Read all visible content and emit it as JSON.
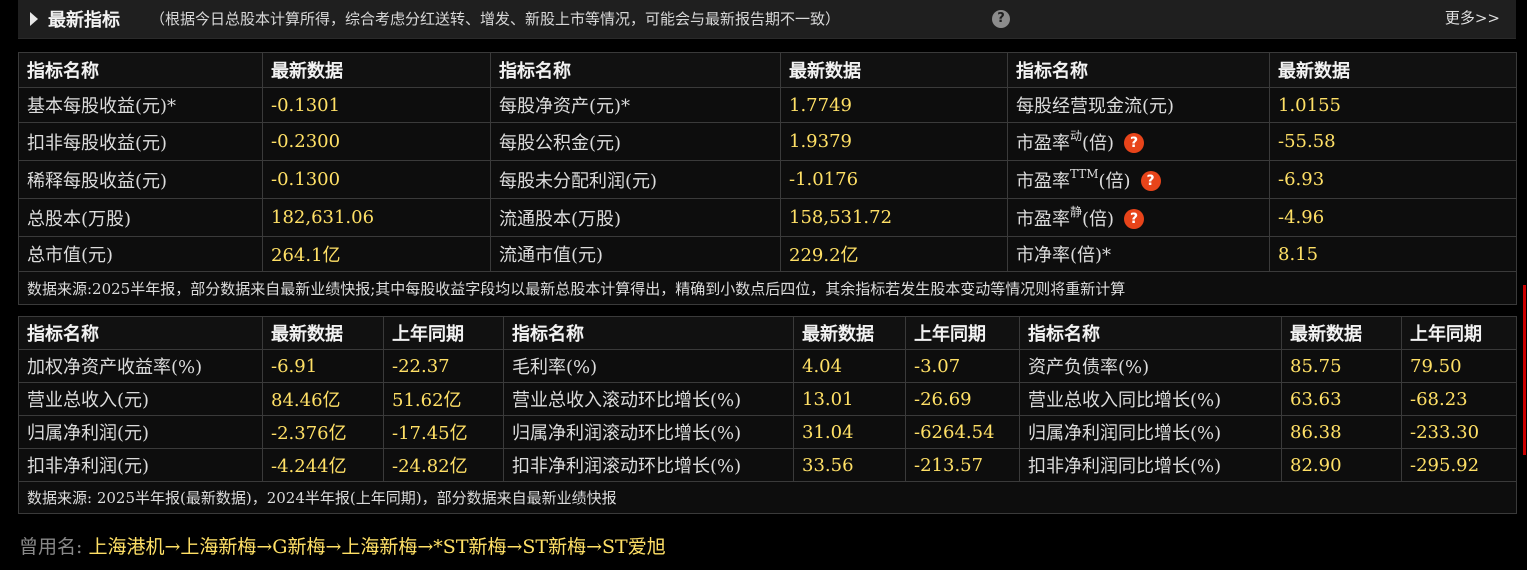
{
  "header": {
    "title": "最新指标",
    "note": "（根据今日总股本计算所得，综合考虑分红送转、增发、新股上市等情况，可能会与最新报告期不一致）",
    "help_icon": "?",
    "more_link": "更多>>"
  },
  "table1": {
    "head": [
      "指标名称",
      "最新数据",
      "指标名称",
      "最新数据",
      "指标名称",
      "最新数据"
    ],
    "rows": [
      {
        "l1": "基本每股收益(元)*",
        "v1": "-0.1301",
        "l2": "每股净资产(元)*",
        "v2": "1.7749",
        "l3": "每股经营现金流(元)",
        "v3": "1.0155"
      },
      {
        "l1": "扣非每股收益(元)",
        "v1": "-0.2300",
        "l2": "每股公积金(元)",
        "v2": "1.9379",
        "l3a": "市盈率",
        "l3sup": "动",
        "l3b": "(倍)",
        "v3": "-55.58"
      },
      {
        "l1": "稀释每股收益(元)",
        "v1": "-0.1300",
        "l2": "每股未分配利润(元)",
        "v2": "-1.0176",
        "l3a": "市盈率",
        "l3sup": "TTM",
        "l3b": "(倍)",
        "v3": "-6.93"
      },
      {
        "l1": "总股本(万股)",
        "v1": "182,631.06",
        "l2": "流通股本(万股)",
        "v2": "158,531.72",
        "l3a": "市盈率",
        "l3sup": "静",
        "l3b": "(倍)",
        "v3": "-4.96"
      },
      {
        "l1": "总市值(元)",
        "v1": "264.1亿",
        "l2": "流通市值(元)",
        "v2": "229.2亿",
        "l3": "市净率(倍)*",
        "v3": "8.15"
      }
    ],
    "note": "数据来源:2025半年报，部分数据来自最新业绩快报;其中每股收益字段均以最新总股本计算得出，精确到小数点后四位，其余指标若发生股本变动等情况则将重新计算",
    "help_icon": "?"
  },
  "table2": {
    "head": [
      "指标名称",
      "最新数据",
      "上年同期",
      "指标名称",
      "最新数据",
      "上年同期",
      "指标名称",
      "最新数据",
      "上年同期"
    ],
    "rows": [
      [
        "加权净资产收益率(%)",
        "-6.91",
        "-22.37",
        "毛利率(%)",
        "4.04",
        "-3.07",
        "资产负债率(%)",
        "85.75",
        "79.50"
      ],
      [
        "营业总收入(元)",
        "84.46亿",
        "51.62亿",
        "营业总收入滚动环比增长(%)",
        "13.01",
        "-26.69",
        "营业总收入同比增长(%)",
        "63.63",
        "-68.23"
      ],
      [
        "归属净利润(元)",
        "-2.376亿",
        "-17.45亿",
        "归属净利润滚动环比增长(%)",
        "31.04",
        "-6264.54",
        "归属净利润同比增长(%)",
        "86.38",
        "-233.30"
      ],
      [
        "扣非净利润(元)",
        "-4.244亿",
        "-24.82亿",
        "扣非净利润滚动环比增长(%)",
        "33.56",
        "-213.57",
        "扣非净利润同比增长(%)",
        "82.90",
        "-295.92"
      ]
    ],
    "note": "数据来源: 2025半年报(最新数据)，2024半年报(上年同期)，部分数据来自最新业绩快报"
  },
  "former_names": {
    "label": "曾用名:",
    "value": "上海港机→上海新梅→G新梅→上海新梅→*ST新梅→ST新梅→ST爱旭"
  },
  "colors": {
    "value": "#ffe066",
    "help_badge": "#e8441a",
    "background": "#000000"
  }
}
